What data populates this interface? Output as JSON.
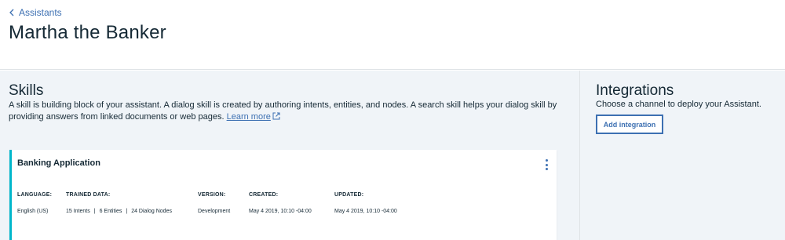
{
  "header": {
    "breadcrumb": "Assistants",
    "title": "Martha the Banker"
  },
  "skills": {
    "title": "Skills",
    "description": "A skill is building block of your assistant. A dialog skill is created by authoring intents, entities, and nodes. A search skill helps your dialog skill by providing answers from linked documents or web pages.",
    "learn_more": "Learn more",
    "card": {
      "title": "Banking Application",
      "language_label": "LANGUAGE:",
      "language_value": "English (US)",
      "trained_label": "TRAINED DATA:",
      "intents": "15 Intents",
      "entities": "6 Entities",
      "dialog_nodes": "24 Dialog Nodes",
      "separator": "|",
      "version_label": "VERSION:",
      "version_value": "Development",
      "created_label": "CREATED:",
      "created_value": "May 4 2019, 10:10 -04:00",
      "updated_label": "UPDATED:",
      "updated_value": "May 4 2019, 10:10 -04:00"
    }
  },
  "integrations": {
    "title": "Integrations",
    "description": "Choose a channel to deploy your Assistant.",
    "add_button": "Add integration"
  },
  "colors": {
    "accent": "#3d70b2",
    "card_stripe": "#00b6cb",
    "panel_bg": "#f0f4f8",
    "text": "#152935"
  },
  "icons": [
    "chevron-left-icon",
    "external-link-icon",
    "overflow-menu-icon"
  ]
}
